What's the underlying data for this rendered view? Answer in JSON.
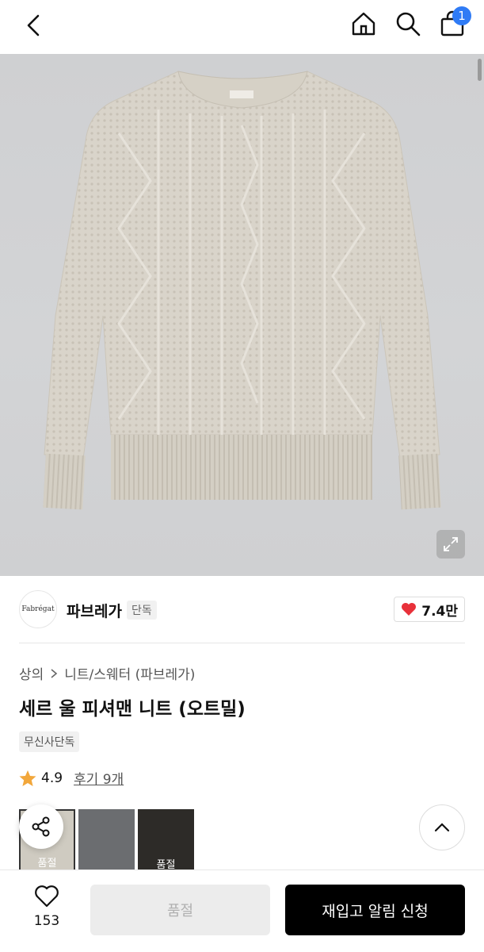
{
  "header": {
    "cart_count": "1"
  },
  "brand": {
    "logo_text": "Fabrégat",
    "name": "파브레가",
    "tag": "단독",
    "likes": "7.4만"
  },
  "product": {
    "breadcrumb": [
      "상의",
      "니트/스웨터 (파브레가)"
    ],
    "title": "세르 울 피셔맨 니트 (오트밀)",
    "exclusive_tag": "무신사단독",
    "rating": "4.9",
    "reviews": "후기 9개"
  },
  "swatches": [
    {
      "label": "품절",
      "color": "#cfcbc1"
    },
    {
      "label": "",
      "color": "#6b6d70"
    },
    {
      "label": "품절",
      "color": "#2d2b28"
    }
  ],
  "bottom": {
    "like_count": "153",
    "soldout_label": "품절",
    "notify_label": "재입고 알림 신청"
  },
  "colors": {
    "accent_blue": "#2f7bf5",
    "heart_red": "#e8313a",
    "star": "#f2a73b"
  }
}
